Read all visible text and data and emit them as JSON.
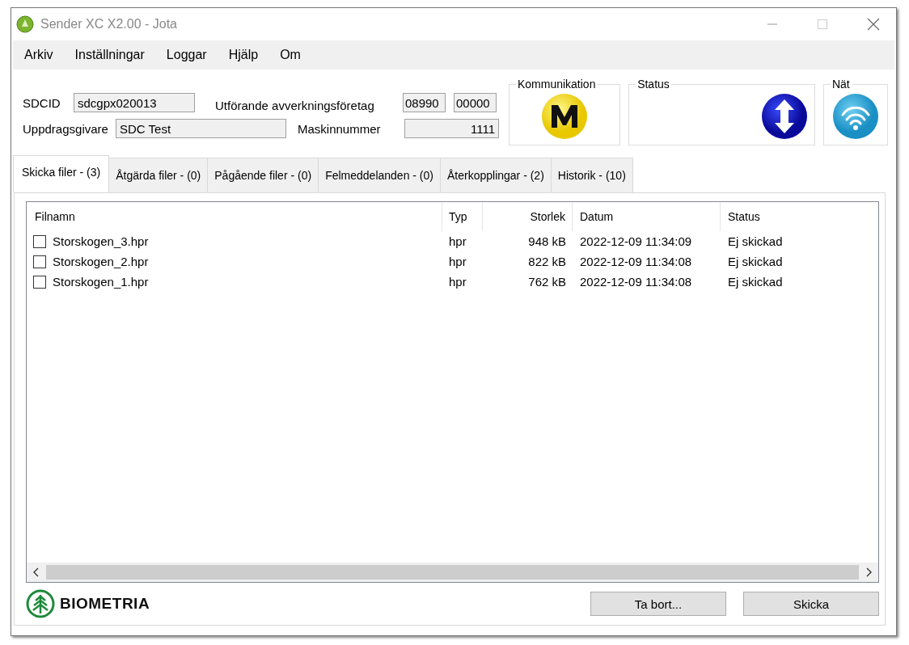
{
  "window": {
    "title": "Sender XC X2.00 - Jota"
  },
  "menu": [
    "Arkiv",
    "Inställningar",
    "Loggar",
    "Hjälp",
    "Om"
  ],
  "form": {
    "sdcid_label": "SDCID",
    "sdcid": "sdcgpx020013",
    "company_label": "Utförande avverkningsföretag",
    "company_code_1": "08990",
    "company_code_2": "00000",
    "client_label": "Uppdragsgivare",
    "client": "SDC Test",
    "machine_label": "Maskinnummer",
    "machine": "1111"
  },
  "groups": {
    "communication": "Kommunikation",
    "status": "Status",
    "network": "Nät"
  },
  "tabs": [
    {
      "label": "Skicka filer - (3)",
      "selected": true
    },
    {
      "label": "Åtgärda filer - (0)",
      "selected": false
    },
    {
      "label": "Pågående filer - (0)",
      "selected": false
    },
    {
      "label": "Felmeddelanden - (0)",
      "selected": false
    },
    {
      "label": "Återkopplingar - (2)",
      "selected": false
    },
    {
      "label": "Historik - (10)",
      "selected": false
    }
  ],
  "table": {
    "columns": [
      "Filnamn",
      "Typ",
      "Storlek",
      "Datum",
      "Status"
    ],
    "rows": [
      {
        "checked": false,
        "cells": [
          "Storskogen_3.hpr",
          "hpr",
          "948 kB",
          "2022-12-09 11:34:09",
          "Ej skickad"
        ]
      },
      {
        "checked": false,
        "cells": [
          "Storskogen_2.hpr",
          "hpr",
          "822 kB",
          "2022-12-09 11:34:08",
          "Ej skickad"
        ]
      },
      {
        "checked": false,
        "cells": [
          "Storskogen_1.hpr",
          "hpr",
          "762 kB",
          "2022-12-09 11:34:08",
          "Ej skickad"
        ]
      }
    ]
  },
  "logo": "BIOMETRIA",
  "buttons": [
    "Ta bort...",
    "Skicka"
  ]
}
